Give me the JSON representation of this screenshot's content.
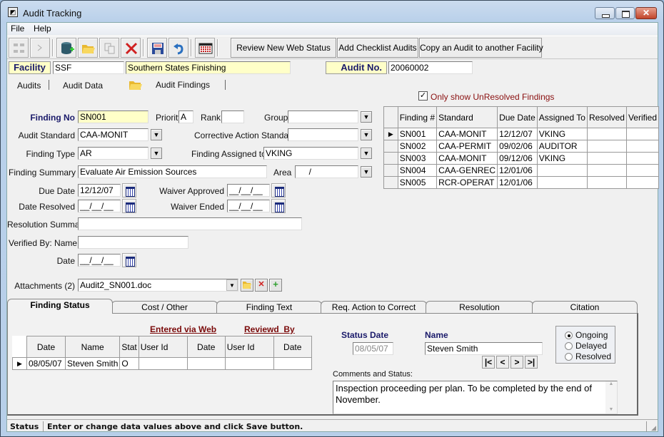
{
  "window": {
    "title": "Audit Tracking",
    "icon": "app-icon"
  },
  "menu": {
    "file": "File",
    "help": "Help"
  },
  "toolbar": {
    "icons": [
      "tree-icon",
      "next-icon",
      "database-add-icon",
      "folder-open-icon",
      "copy-icon",
      "delete-icon",
      "save-icon",
      "undo-icon",
      "calendar-grid-icon"
    ],
    "review_label": "Review New Web Status",
    "checklist_label": "Add Checklist Audits",
    "copy_audit_label": "Copy an Audit to another Facility"
  },
  "header": {
    "facility_label": "Facility",
    "facility_code": "SSF",
    "facility_name": "Southern States Finishing",
    "audit_no_label": "Audit No.",
    "audit_no": "20060002"
  },
  "nav_tabs": [
    "Audits",
    "Audit Data",
    "Audit Findings"
  ],
  "form": {
    "finding_no_label": "Finding No",
    "finding_no": "SN001",
    "priority_label": "Priority",
    "priority": "A",
    "rank_label": "Rank",
    "rank": "",
    "group_label": "Group",
    "group": "",
    "audit_standard_label": "Audit Standard",
    "audit_standard": "CAA-MONIT",
    "corrective_label": "Corrective Action Standard",
    "corrective": "",
    "finding_type_label": "Finding Type",
    "finding_type": "AR",
    "assigned_label": "Finding Assigned to",
    "assigned": "VKING",
    "summary_label": "Finding Summary",
    "summary": "Evaluate Air Emission Sources",
    "area_label": "Area",
    "area": "     /",
    "due_date_label": "Due Date",
    "due_date": "12/12/07",
    "waiver_approved_label": "Waiver Approved",
    "waiver_approved": "__/__/__",
    "date_resolved_label": "Date Resolved",
    "date_resolved": "__/__/__",
    "waiver_ended_label": "Waiver Ended",
    "waiver_ended": "__/__/__",
    "resolution_summary_label": "Resolution Summary",
    "resolution_summary": "",
    "verified_name_label": "Verified By:  Name",
    "verified_name": "",
    "verified_date_label": "Date",
    "verified_date": "__/__/__",
    "attachments_label": "Attachments (2)",
    "attachment": "Audit2_SN001.doc"
  },
  "findings": {
    "filter_label": "Only show UnResolved Findings",
    "filter_checked": true,
    "columns": [
      "Finding #",
      "Standard",
      "Due Date",
      "Assigned To",
      "Resolved",
      "Verified"
    ],
    "rows": [
      [
        "SN001",
        "CAA-MONIT",
        "12/12/07",
        "VKING",
        "",
        ""
      ],
      [
        "SN002",
        "CAA-PERMIT",
        "09/02/06",
        "AUDITOR",
        "",
        ""
      ],
      [
        "SN003",
        "CAA-MONIT",
        "09/12/06",
        "VKING",
        "",
        ""
      ],
      [
        "SN004",
        "CAA-GENREC",
        "12/01/06",
        "",
        "",
        ""
      ],
      [
        "SN005",
        "RCR-OPERAT",
        "12/01/06",
        "",
        "",
        ""
      ]
    ]
  },
  "detail_tabs": [
    "Finding Status",
    "Cost / Other",
    "Finding Text",
    "Req. Action to Correct",
    "Resolution",
    "Citation"
  ],
  "status_panel": {
    "entered_via_web": "Entered via Web",
    "reviewed_by": "Reviewd  By",
    "columns": [
      "Date",
      "Name",
      "Stat",
      "User Id",
      "Date",
      "User Id",
      "Date"
    ],
    "rows": [
      [
        "08/05/07",
        "Steven Smith",
        "O",
        "",
        "",
        "",
        ""
      ]
    ],
    "status_date_label": "Status Date",
    "status_date": "08/05/07",
    "name_label": "Name",
    "name": "Steven Smith",
    "nav": [
      "|<",
      "<",
      ">",
      ">|"
    ],
    "options": [
      {
        "label": "Ongoing",
        "selected": true
      },
      {
        "label": "Delayed",
        "selected": false
      },
      {
        "label": "Resolved",
        "selected": false
      }
    ],
    "comments_label": "Comments and  Status:",
    "comments": "Inspection proceeding per plan. To be completed by the end of November."
  },
  "statusbar": {
    "label": "Status",
    "message": "Enter or change data values above and click Save button."
  }
}
